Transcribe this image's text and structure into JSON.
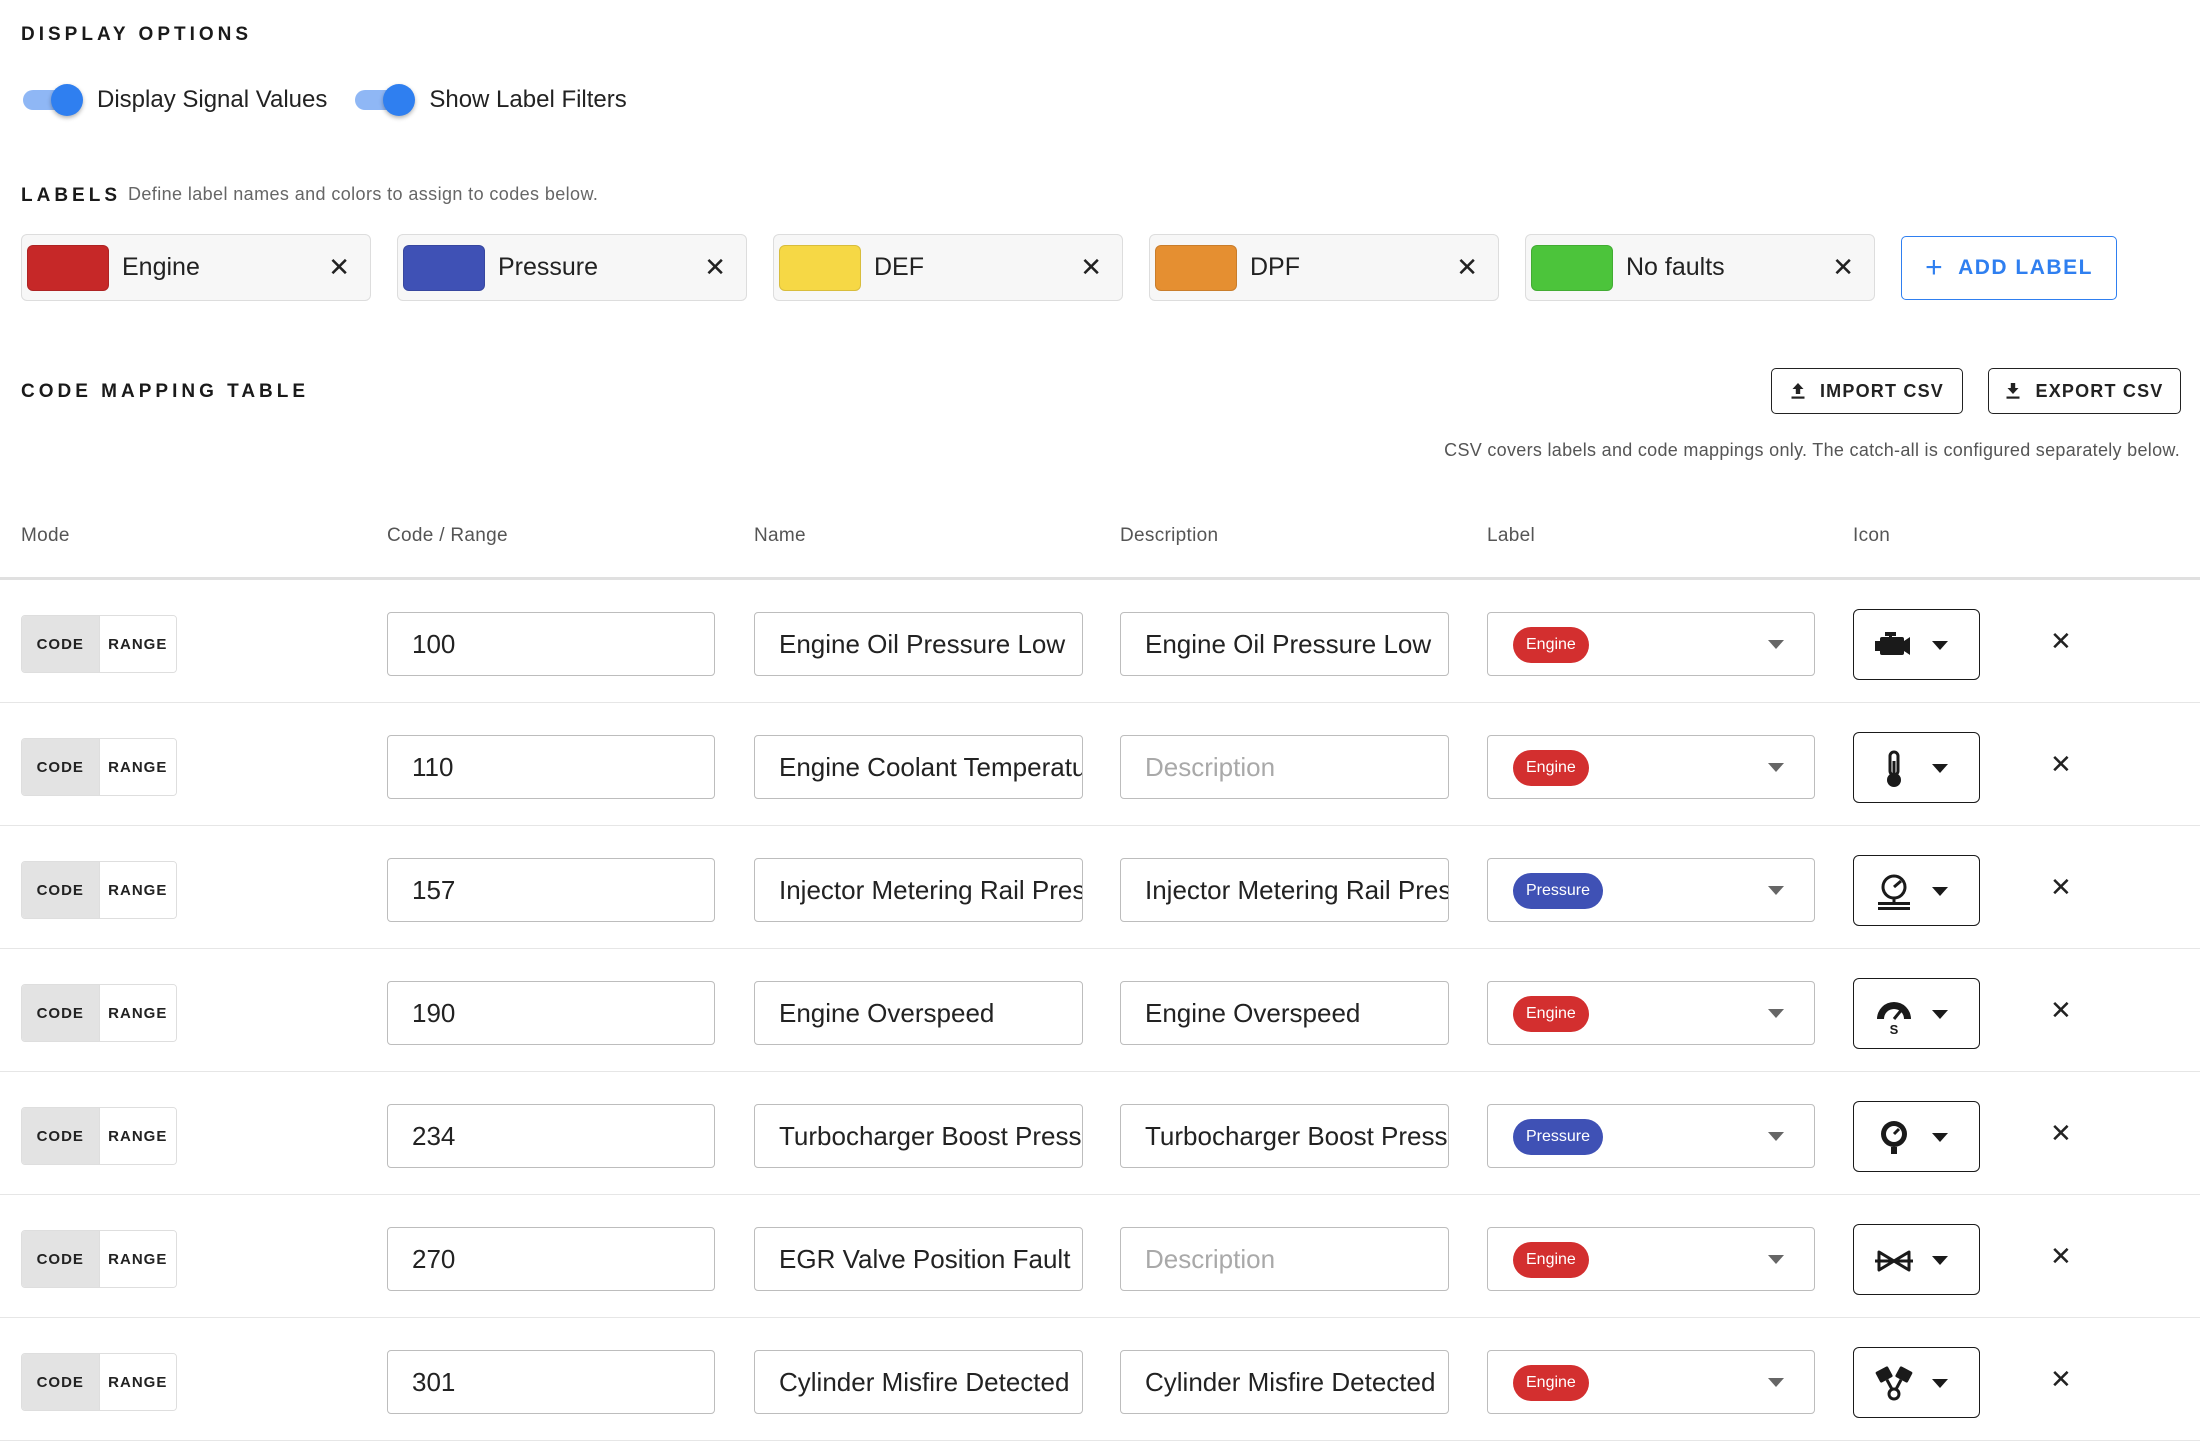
{
  "display_options": {
    "title": "DISPLAY OPTIONS",
    "toggles": [
      {
        "label": "Display Signal Values",
        "on": true
      },
      {
        "label": "Show Label Filters",
        "on": true
      }
    ]
  },
  "labels": {
    "title": "LABELS",
    "hint": "Define label names and colors to assign to codes below.",
    "items": [
      {
        "name": "Engine",
        "color": "#c62828"
      },
      {
        "name": "Pressure",
        "color": "#3f51b5"
      },
      {
        "name": "DEF",
        "color": "#f6d845"
      },
      {
        "name": "DPF",
        "color": "#e58f31"
      },
      {
        "name": "No faults",
        "color": "#4cc43b"
      }
    ],
    "remove_symbol": "✕",
    "add_plus": "+",
    "add_label": "ADD LABEL"
  },
  "code_table": {
    "title": "CODE MAPPING TABLE",
    "import_label": "IMPORT CSV",
    "export_label": "EXPORT CSV",
    "csv_note": "CSV covers labels and code mappings only. The catch-all is configured separately below.",
    "headers": {
      "mode": "Mode",
      "code": "Code / Range",
      "name": "Name",
      "description": "Description",
      "label": "Label",
      "icon": "Icon"
    },
    "mode_code": "CODE",
    "mode_range": "RANGE",
    "description_placeholder": "Description",
    "remove_symbol": "✕",
    "rows": [
      {
        "code": "100",
        "name": "Engine Oil Pressure Low",
        "description": "Engine Oil Pressure Low",
        "label": "Engine",
        "label_color": "#d32f2f",
        "icon": "engine-icon"
      },
      {
        "code": "110",
        "name": "Engine Coolant Temperature",
        "description": "",
        "label": "Engine",
        "label_color": "#d32f2f",
        "icon": "thermometer-icon"
      },
      {
        "code": "157",
        "name": "Injector Metering Rail Pressure",
        "description": "Injector Metering Rail Pressure",
        "label": "Pressure",
        "label_color": "#3f51b5",
        "icon": "pressure-gauge-icon"
      },
      {
        "code": "190",
        "name": "Engine Overspeed",
        "description": "Engine Overspeed",
        "label": "Engine",
        "label_color": "#d32f2f",
        "icon": "speedometer-icon"
      },
      {
        "code": "234",
        "name": "Turbocharger Boost Pressure",
        "description": "Turbocharger Boost Pressure",
        "label": "Pressure",
        "label_color": "#3f51b5",
        "icon": "boost-gauge-icon"
      },
      {
        "code": "270",
        "name": "EGR Valve Position Fault",
        "description": "",
        "label": "Engine",
        "label_color": "#d32f2f",
        "icon": "valve-icon"
      },
      {
        "code": "301",
        "name": "Cylinder Misfire Detected",
        "description": "Cylinder Misfire Detected",
        "label": "Engine",
        "label_color": "#d32f2f",
        "icon": "pistons-icon"
      }
    ]
  }
}
